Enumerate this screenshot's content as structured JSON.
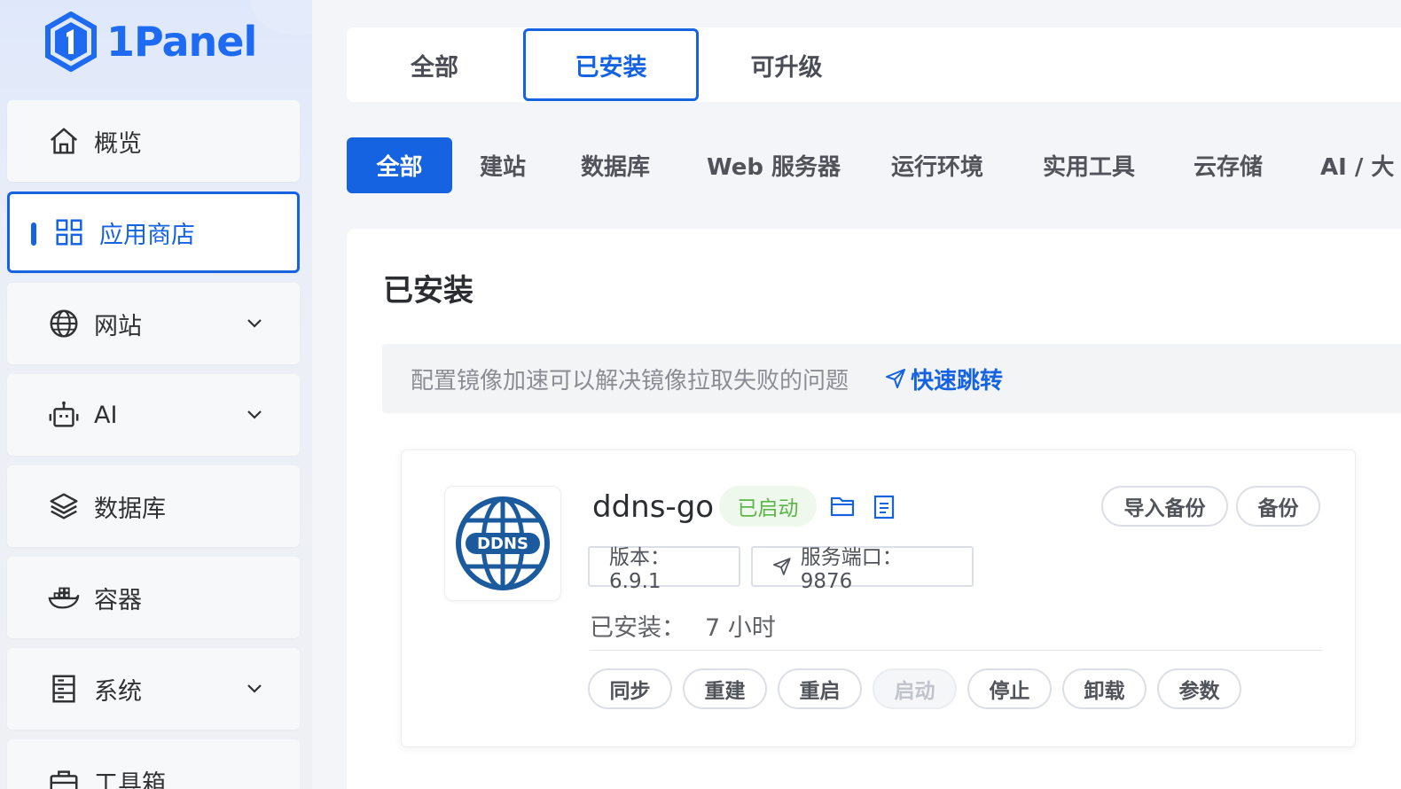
{
  "brand": {
    "name": "1Panel",
    "logo_icon": "hexagon-1-logo"
  },
  "sidebar": {
    "items": [
      {
        "label": "概览",
        "icon": "home-icon",
        "active": false,
        "expandable": false
      },
      {
        "label": "应用商店",
        "icon": "grid-icon",
        "active": true,
        "expandable": false
      },
      {
        "label": "网站",
        "icon": "globe-icon",
        "active": false,
        "expandable": true
      },
      {
        "label": "AI",
        "icon": "robot-icon",
        "active": false,
        "expandable": true
      },
      {
        "label": "数据库",
        "icon": "layers-icon",
        "active": false,
        "expandable": false
      },
      {
        "label": "容器",
        "icon": "docker-whale-icon",
        "active": false,
        "expandable": false
      },
      {
        "label": "系统",
        "icon": "server-icon",
        "active": false,
        "expandable": true
      },
      {
        "label": "工具箱",
        "icon": "toolbox-icon",
        "active": false,
        "expandable": false
      }
    ]
  },
  "top_tabs": [
    {
      "label": "全部",
      "active": false
    },
    {
      "label": "已安装",
      "active": true
    },
    {
      "label": "可升级",
      "active": false
    }
  ],
  "categories": [
    {
      "label": "全部",
      "active": true
    },
    {
      "label": "建站",
      "active": false
    },
    {
      "label": "数据库",
      "active": false
    },
    {
      "label": "Web 服务器",
      "active": false
    },
    {
      "label": "运行环境",
      "active": false
    },
    {
      "label": "实用工具",
      "active": false
    },
    {
      "label": "云存储",
      "active": false
    },
    {
      "label": "AI / 大",
      "active": false
    }
  ],
  "main": {
    "title": "已安装",
    "notice": {
      "text": "配置镜像加速可以解决镜像拉取失败的问题",
      "link_label": "快速跳转"
    },
    "app": {
      "name": "ddns-go",
      "icon_text": "DDNS",
      "status": "已启动",
      "import_backup_label": "导入备份",
      "backup_label": "备份",
      "version_tag": "版本：6.9.1",
      "port_tag": "服务端口：9876",
      "installed_label": "已安装：",
      "installed_value": "7 小时",
      "actions": [
        {
          "label": "同步",
          "disabled": false
        },
        {
          "label": "重建",
          "disabled": false
        },
        {
          "label": "重启",
          "disabled": false
        },
        {
          "label": "启动",
          "disabled": true
        },
        {
          "label": "停止",
          "disabled": false
        },
        {
          "label": "卸载",
          "disabled": false
        },
        {
          "label": "参数",
          "disabled": false
        }
      ]
    }
  },
  "colors": {
    "primary": "#1563e0",
    "success_text": "#5cb548",
    "success_bg": "#eef8ec"
  }
}
